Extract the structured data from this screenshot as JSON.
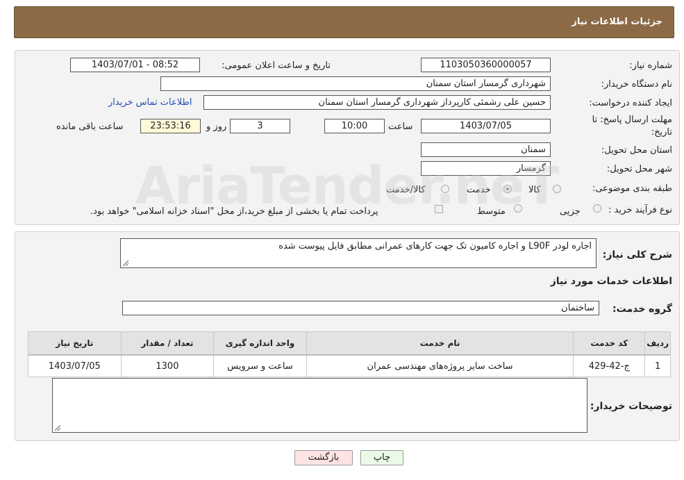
{
  "header": {
    "title": "جزئیات اطلاعات نیاز"
  },
  "form": {
    "need_number_label": "شماره نیاز:",
    "need_number": "1103050360000057",
    "announce_label": "تاریخ و ساعت اعلان عمومی:",
    "announce_value": "1403/07/01 - 08:52",
    "buyer_org_label": "نام دستگاه خریدار:",
    "buyer_org": "شهرداری گرمسار استان سمنان",
    "creator_label": "ایجاد کننده درخواست:",
    "creator": "حسین علی رشمئی کارپرداز شهرداری گرمسار استان سمنان",
    "contact_link": "اطلاعات تماس خریدار",
    "deadline_label_1": "مهلت ارسال پاسخ: تا",
    "deadline_label_2": "تاریخ:",
    "deadline_date": "1403/07/05",
    "time_label": "ساعت",
    "deadline_time": "10:00",
    "days_value": "3",
    "days_label": "روز و",
    "remaining_time": "23:53:16",
    "remaining_label": "ساعت باقی مانده",
    "province_label": "استان محل تحویل:",
    "province": "سمنان",
    "city_label": "شهر محل تحویل:",
    "city": "گرمسار",
    "category_label": "طبقه بندی موضوعی:",
    "category_options": [
      "کالا",
      "خدمت",
      "کالا/خدمت"
    ],
    "category_selected": "خدمت",
    "process_label": "نوع فرآیند خرید :",
    "process_options": [
      "جزیی",
      "متوسط"
    ],
    "payment_note": "پرداخت تمام یا بخشی از مبلغ خرید،از محل \"اسناد خزانه اسلامی\" خواهد بود."
  },
  "details": {
    "description_label": "شرح کلی نیاز:",
    "description": "اجاره لودر L90F و اجاره کامیون تک جهت کارهای عمرانی مطابق فایل پیوست شده",
    "services_heading": "اطلاعات خدمات مورد نیاز",
    "service_group_label": "گروه خدمت:",
    "service_group": "ساختمان",
    "table": {
      "headers": [
        "ردیف",
        "کد خدمت",
        "نام خدمت",
        "واحد اندازه گیری",
        "تعداد / مقدار",
        "تاریخ نیاز"
      ],
      "rows": [
        [
          "1",
          "ج-42-429",
          "ساخت سایر پروژه‌های مهندسی عمران",
          "ساعت و سرویس",
          "1300",
          "1403/07/05"
        ]
      ]
    },
    "buyer_notes_label": "توضیحات خریدار:",
    "buyer_notes": ""
  },
  "buttons": {
    "print": "چاپ",
    "back": "بازگشت"
  },
  "watermark": "AriaTender.neT",
  "colors": {
    "header_bg": "#8b6a45",
    "link": "#1f4fb8",
    "back_button_bg": "#fde3e3",
    "print_button_bg": "#e9fbe5"
  }
}
